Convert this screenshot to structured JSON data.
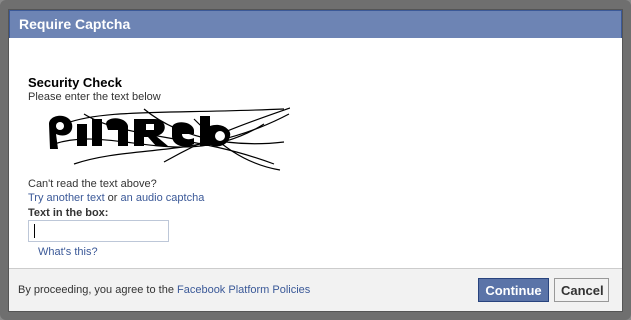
{
  "dialog": {
    "title": "Require Captcha"
  },
  "security": {
    "title": "Security Check",
    "instruction": "Please enter the text below"
  },
  "captcha": {
    "words": [
      "",
      ""
    ],
    "cant_read": "Can't read the text above?",
    "try_another": "Try another text",
    "or": " or ",
    "audio": "an audio captcha",
    "box_label": "Text in the box:",
    "input_value": "",
    "whats_this": "What's this?"
  },
  "footer": {
    "text": "By proceeding, you agree to the ",
    "policy_link": "Facebook Platform Policies",
    "continue_label": "Continue",
    "cancel_label": "Cancel"
  },
  "colors": {
    "header_bg": "#6d84b4",
    "link": "#3b5998",
    "continue_bg": "#5b74a8"
  }
}
